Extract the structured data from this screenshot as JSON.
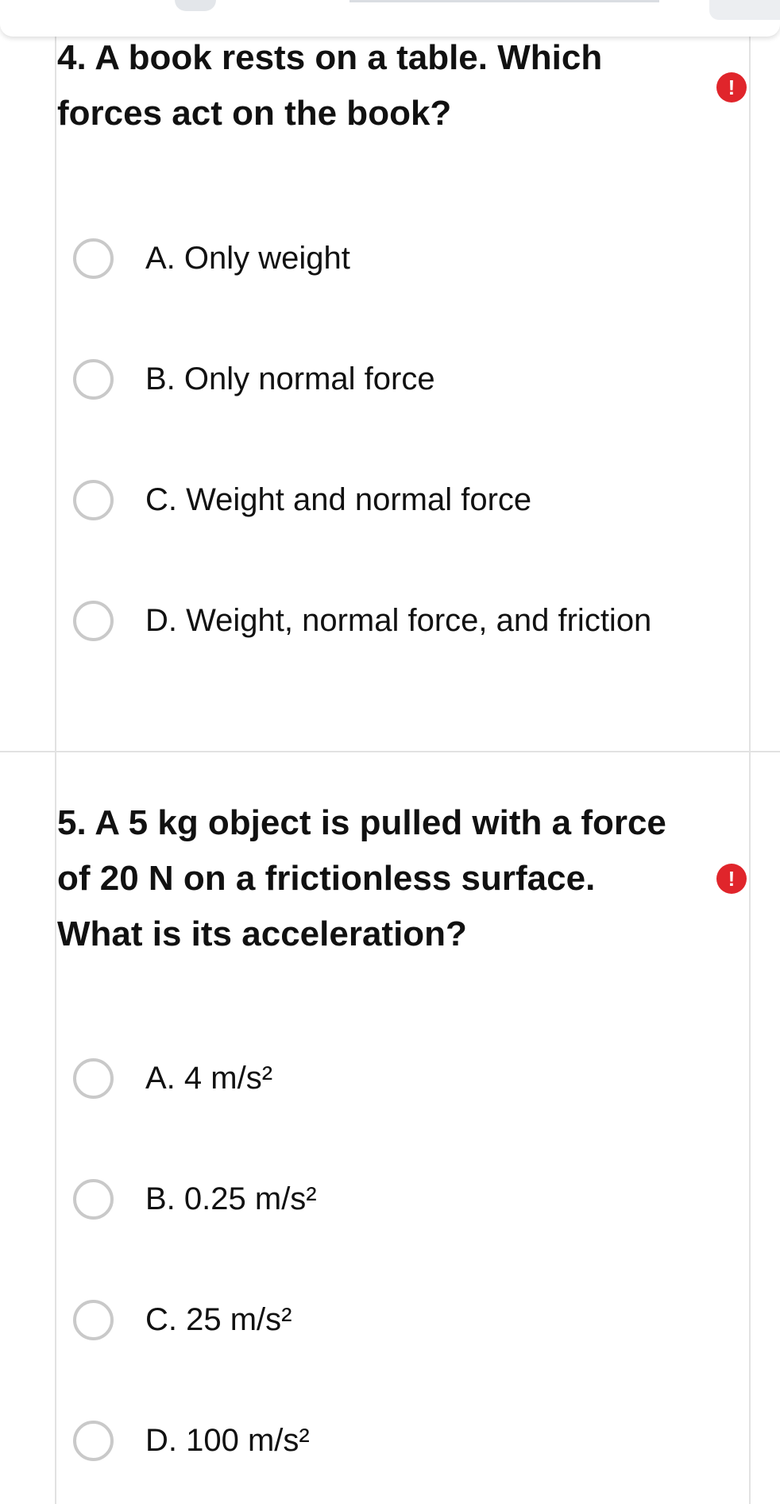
{
  "questions": [
    {
      "text": "4. A book rests on a table. Which forces act on the book?",
      "required_icon": "!",
      "options": [
        "A. Only weight",
        "B. Only normal force",
        "C. Weight and normal force",
        "D. Weight, normal force, and friction"
      ]
    },
    {
      "text": "5. A 5 kg object is pulled with a force of 20 N on a frictionless surface. What is its acceleration?",
      "required_icon": "!",
      "options": [
        "A. 4 m/s²",
        "B. 0.25 m/s²",
        "C. 25 m/s²",
        "D. 100 m/s²"
      ]
    }
  ],
  "colors": {
    "required_badge": "#e0252b",
    "radio_border": "#c9c9c9",
    "divider": "#e2e2e2"
  }
}
